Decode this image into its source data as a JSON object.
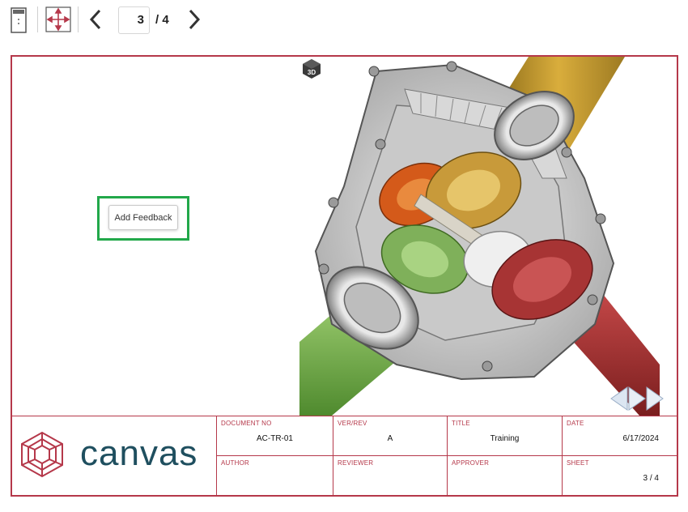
{
  "toolbar": {
    "current_page": "3",
    "page_total": "/ 4"
  },
  "viewer": {
    "feedback_button_label": "Add Feedback"
  },
  "title_block": {
    "logo_text": "canvas",
    "document_no": {
      "label": "DOCUMENT NO",
      "value": "AC-TR-01"
    },
    "ver_rev": {
      "label": "VER/REV",
      "value": "A"
    },
    "title": {
      "label": "TITLE",
      "value": "Training"
    },
    "date": {
      "label": "DATE",
      "value": "6/17/2024"
    },
    "author": {
      "label": "AUTHOR",
      "value": ""
    },
    "reviewer": {
      "label": "REVIEWER",
      "value": ""
    },
    "approver": {
      "label": "APPROVER",
      "value": ""
    },
    "sheet": {
      "label": "SHEET",
      "value": "3 / 4"
    }
  },
  "colors": {
    "frame": "#b5384a",
    "highlight": "#22a84a",
    "logo_text": "#1f4f5f"
  },
  "icons": [
    "panel-toggle-icon",
    "fit-view-icon",
    "chevron-left-icon",
    "chevron-right-icon",
    "3d-cube-icon",
    "canvas-logo-icon",
    "carousel-arrows-icon"
  ]
}
